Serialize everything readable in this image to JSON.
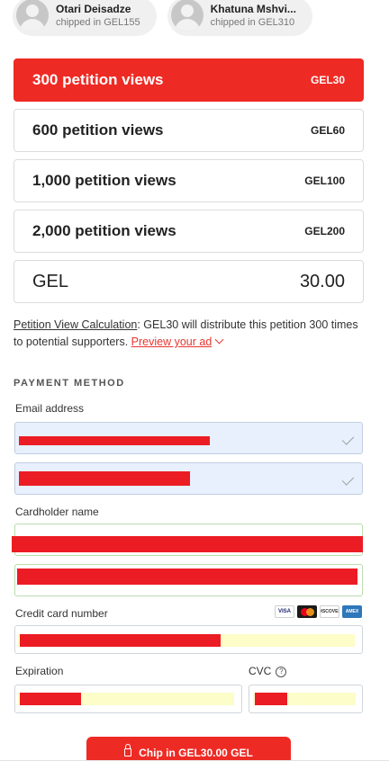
{
  "supporters": [
    {
      "name": "Otari Deisadze",
      "note": "chipped in GEL155"
    },
    {
      "name": "Khatuna Mshvi...",
      "note": "chipped in GEL310"
    }
  ],
  "tiers": [
    {
      "label": "300 petition views",
      "price": "GEL30",
      "selected": true
    },
    {
      "label": "600 petition views",
      "price": "GEL60",
      "selected": false
    },
    {
      "label": "1,000 petition views",
      "price": "GEL100",
      "selected": false
    },
    {
      "label": "2,000 petition views",
      "price": "GEL200",
      "selected": false
    }
  ],
  "amount": {
    "currency": "GEL",
    "value": "30.00"
  },
  "calculation": {
    "link": "Petition View Calculation",
    "text": ": GEL30 will distribute this petition 300 times to potential supporters. ",
    "preview": "Preview your ad"
  },
  "payment": {
    "section_title": "PAYMENT METHOD",
    "email_label": "Email address",
    "cardholder_label": "Cardholder name",
    "card_number_label": "Credit card number",
    "card_brands": [
      "VISA",
      "MC",
      "DISCOVER",
      "AMEX"
    ],
    "expiration_label": "Expiration",
    "cvc_label": "CVC",
    "help_glyph": "?"
  },
  "cta": {
    "label": "Chip in GEL30.00 GEL"
  },
  "colors": {
    "accent": "#ee2a24",
    "autofill": "#e8f0fe",
    "redaction": "#ec1c24"
  }
}
